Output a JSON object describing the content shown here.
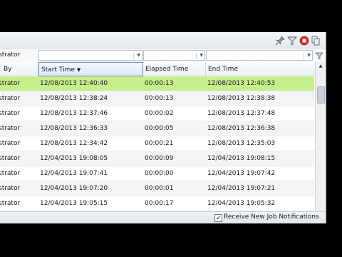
{
  "toolbar": {
    "icons": [
      "pin-icon",
      "filter-icon",
      "stop-icon",
      "copy-icon"
    ]
  },
  "filters": {
    "first_value": "strator"
  },
  "columns": {
    "submitted_by": "By",
    "start_time": "Start Time",
    "elapsed_time": "Elapsed Time",
    "end_time": "End Time",
    "sort_indicator": "▼"
  },
  "rows": [
    {
      "by": "strator",
      "start": "12/08/2013 12:40:40",
      "elapsed": "00:00:13",
      "end": "12/08/2013 12:40:53",
      "selected": true
    },
    {
      "by": "strator",
      "start": "12/08/2013 12:38:24",
      "elapsed": "00:00:13",
      "end": "12/08/2013 12:38:38"
    },
    {
      "by": "strator",
      "start": "12/08/2013 12:37:46",
      "elapsed": "00:00:02",
      "end": "12/08/2013 12:37:48"
    },
    {
      "by": "strator",
      "start": "12/08/2013 12:36:33",
      "elapsed": "00:00:05",
      "end": "12/08/2013 12:36:38"
    },
    {
      "by": "strator",
      "start": "12/08/2013 12:34:42",
      "elapsed": "00:00:21",
      "end": "12/08/2013 12:35:03"
    },
    {
      "by": "strator",
      "start": "12/04/2013 19:08:05",
      "elapsed": "00:00:09",
      "end": "12/04/2013 19:08:15"
    },
    {
      "by": "strator",
      "start": "12/04/2013 19:07:41",
      "elapsed": "00:00:00",
      "end": "12/04/2013 19:07:42"
    },
    {
      "by": "strator",
      "start": "12/04/2013 19:07:20",
      "elapsed": "00:00:01",
      "end": "12/04/2013 19:07:21"
    },
    {
      "by": "strator",
      "start": "12/04/2013 19:05:15",
      "elapsed": "00:00:17",
      "end": "12/04/2013 19:05:32"
    }
  ],
  "footer": {
    "notify_label": "Receive New Job Notifications",
    "notify_checked": true
  },
  "colors": {
    "selected_row": "#c6ee8c",
    "stop_icon": "#d92b2b"
  }
}
